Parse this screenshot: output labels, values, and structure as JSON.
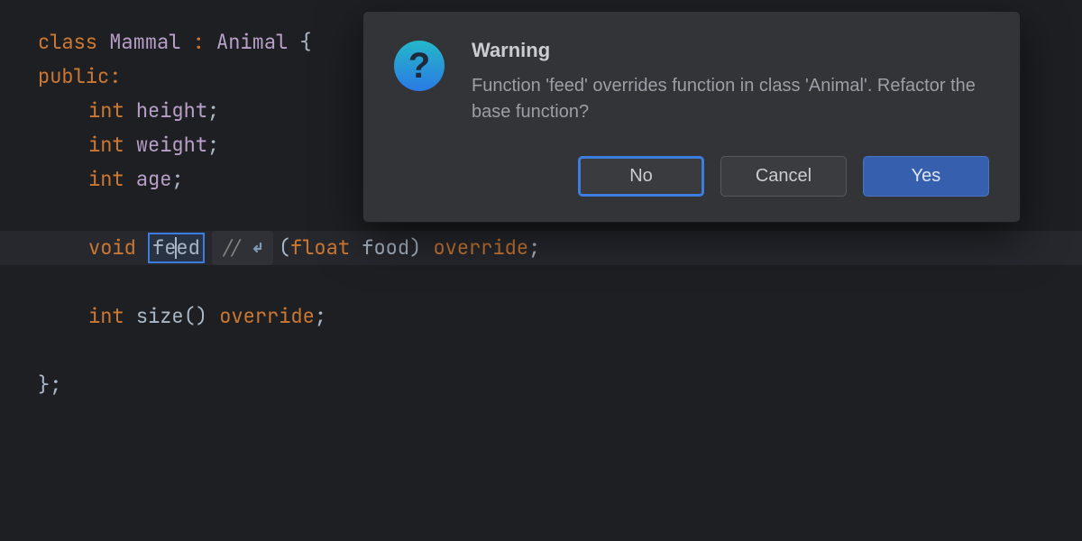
{
  "code": {
    "kw_class": "class",
    "classname": "Mammal",
    "colon": " : ",
    "base": "Animal",
    "brace_open": " {",
    "kw_public": "public",
    "public_colon": ":",
    "type_int": "int",
    "m_height": "height",
    "m_weight": "weight",
    "m_age": "age",
    "semi": ";",
    "kw_void": "void",
    "fn_feed": "feed",
    "hint_slash": "//",
    "lparen": "(",
    "type_float": "float",
    "param_food": " food",
    "rparen": ")",
    "kw_override": " override",
    "fn_size": "size",
    "empty_parens": "()",
    "brace_close": "};"
  },
  "dialog": {
    "title": "Warning",
    "message": "Function 'feed' overrides function in class 'Animal'. Refactor the base function?",
    "btn_no": "No",
    "btn_cancel": "Cancel",
    "btn_yes": "Yes"
  }
}
